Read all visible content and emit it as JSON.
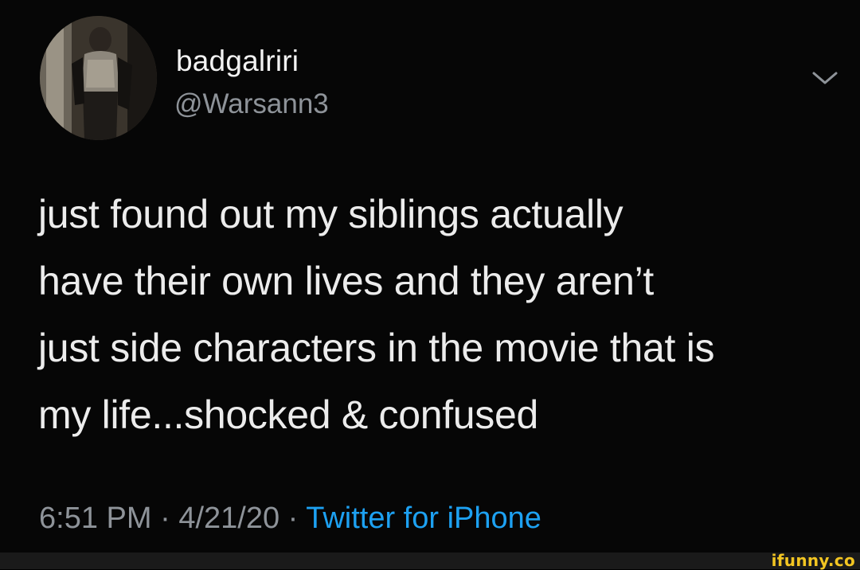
{
  "author": {
    "display_name": "badgalriri",
    "handle": "@Warsann3"
  },
  "tweet": {
    "text": "just found out my siblings actually\nhave their own lives and they aren’t\njust side characters in the movie that is\nmy life...shocked & confused",
    "time": "6:51 PM",
    "date": "4/21/20",
    "separator": " · ",
    "source": "Twitter for iPhone"
  },
  "icons": {
    "avatar": "profile-photo",
    "menu": "chevron-down-icon"
  },
  "colors": {
    "background": "#060606",
    "text": "#ececec",
    "secondary": "#8e9399",
    "link": "#1da1f2",
    "watermark": "#f2c522"
  },
  "watermark": {
    "text": "ifunny.co"
  }
}
